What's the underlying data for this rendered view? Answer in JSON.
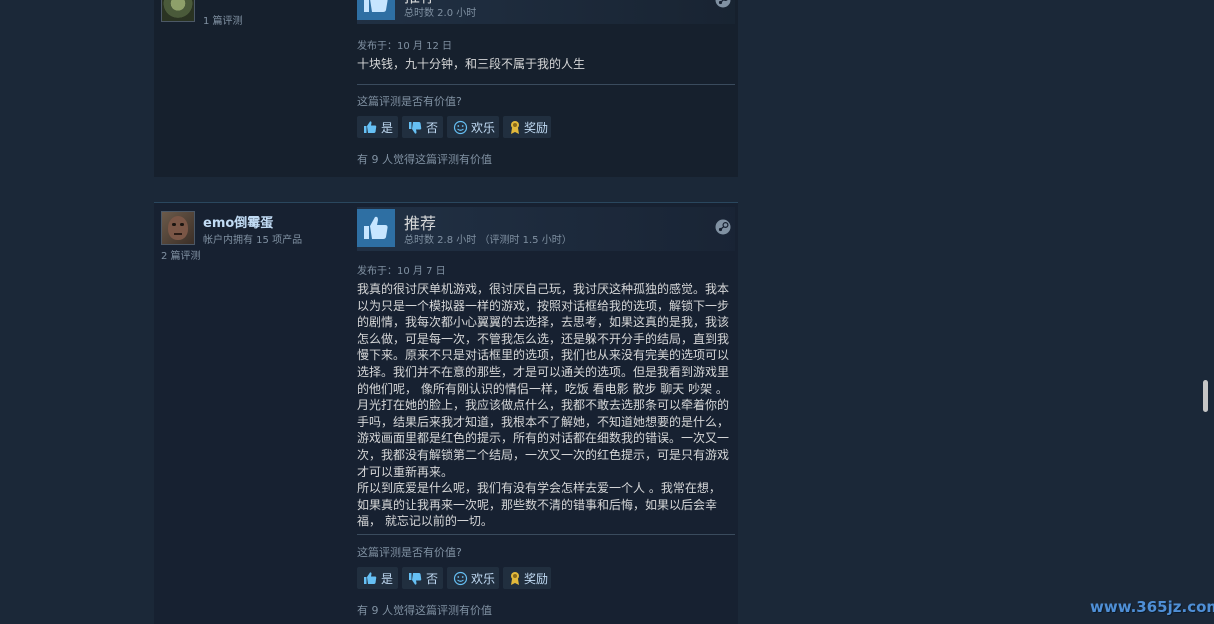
{
  "colors": {
    "background": "#1b2838",
    "review_bg": "#16202d",
    "recommend_blue": "#2e6fa3",
    "link": "#c1dbf4",
    "text": "#d6d7d8",
    "muted": "#8091a2",
    "award_gold": "#e2b93b"
  },
  "reviews": [
    {
      "author": {
        "review_count": "1 篇评测",
        "avatar_icon": "avatar-icon"
      },
      "recommendation": "推荐",
      "hours": "总时数 2.0 小时",
      "posted": "发布于：10 月 12 日",
      "content": "十块钱，九十分钟，和三段不属于我的人生",
      "helpful_question": "这篇评测是否有价值?",
      "buttons": {
        "yes": "是",
        "no": "否",
        "funny": "欢乐",
        "award": "奖励"
      },
      "found_helpful": "有 9 人觉得这篇评测有价值"
    },
    {
      "author": {
        "name": "emo倒霉蛋",
        "products": "帐户内拥有 15 项产品",
        "review_count": "2 篇评测",
        "avatar_icon": "avatar-icon"
      },
      "recommendation": "推荐",
      "hours": "总时数 2.8 小时 （评测时 1.5 小时）",
      "posted": "发布于：10 月 7 日",
      "content": "我真的很讨厌单机游戏，很讨厌自己玩，我讨厌这种孤独的感觉。我本以为只是一个模拟器一样的游戏，按照对话框给我的选项，解锁下一步的剧情，我每次都小心翼翼的去选择，去思考，如果这真的是我，我该怎么做，可是每一次，不管我怎么选，还是躲不开分手的结局，直到我慢下来。原来不只是对话框里的选项，我们也从来没有完美的选项可以选择。我们并不在意的那些，才是可以通关的选项。但是我看到游戏里的他们呢， 像所有刚认识的情侣一样，吃饭 看电影 散步 聊天 吵架 。 月光打在她的脸上，我应该做点什么，我都不敢去选那条可以牵着你的手吗，结果后来我才知道，我根本不了解她，不知道她想要的是什么，游戏画面里都是红色的提示，所有的对话都在细数我的错误。一次又一次，我都没有解锁第二个结局，一次又一次的红色提示，可是只有游戏才可以重新再来。\n所以到底爱是什么呢，我们有没有学会怎样去爱一个人 。我常在想，如果真的让我再来一次呢，那些数不清的错事和后悔，如果以后会幸福， 就忘记以前的一切。",
      "helpful_question": "这篇评测是否有价值?",
      "buttons": {
        "yes": "是",
        "no": "否",
        "funny": "欢乐",
        "award": "奖励"
      },
      "found_helpful": "有 9 人觉得这篇评测有价值"
    }
  ],
  "watermark": "www.365jz.com"
}
